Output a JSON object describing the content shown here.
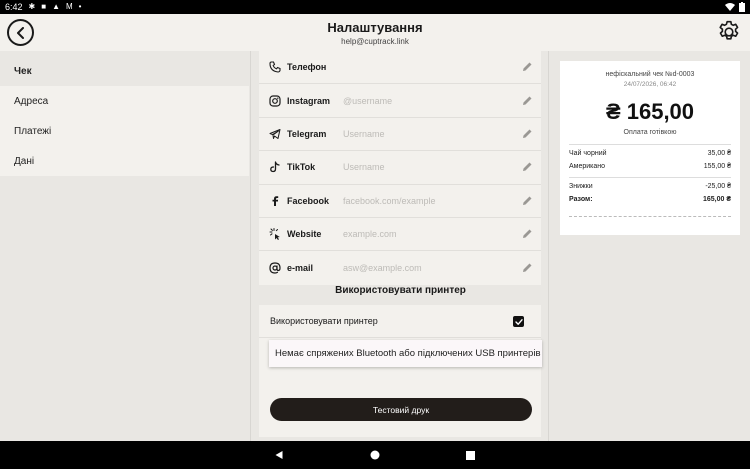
{
  "statusbar": {
    "time": "6:42"
  },
  "header": {
    "title": "Налаштування",
    "subtitle": "help@cuptrack.link"
  },
  "sidebar": {
    "items": [
      {
        "label": "Чек"
      },
      {
        "label": "Адреса"
      },
      {
        "label": "Платежі"
      },
      {
        "label": "Дані"
      }
    ]
  },
  "contacts": {
    "rows": [
      {
        "label": "Телефон",
        "placeholder": "",
        "icon": "phone-icon"
      },
      {
        "label": "Instagram",
        "placeholder": "@username",
        "icon": "instagram-icon"
      },
      {
        "label": "Telegram",
        "placeholder": "Username",
        "icon": "telegram-icon"
      },
      {
        "label": "TikTok",
        "placeholder": "Username",
        "icon": "tiktok-icon"
      },
      {
        "label": "Facebook",
        "placeholder": "facebook.com/example",
        "icon": "facebook-icon"
      },
      {
        "label": "Website",
        "placeholder": "example.com",
        "icon": "website-icon"
      },
      {
        "label": "e-mail",
        "placeholder": "asw@example.com",
        "icon": "email-icon"
      }
    ]
  },
  "printer": {
    "section_title": "Використовувати принтер",
    "toggle_label": "Використовувати принтер",
    "checked": true,
    "test_button": "Тестовий друк",
    "toast": "Немає спряжених Bluetooth або підключених USB принтерів"
  },
  "receipt": {
    "header": "нефіскальний чек №d-0003",
    "date": "24/07/2026, 06:42",
    "total": "₴ 165,00",
    "payment": "Оплата готівкою",
    "items": [
      {
        "name": "Чай чорний",
        "price": "35,00 ₴"
      },
      {
        "name": "Американо",
        "price": "155,00 ₴"
      }
    ],
    "discount": {
      "name": "Знижки",
      "value": "-25,00 ₴"
    },
    "sum": {
      "name": "Разом:",
      "value": "165,00 ₴"
    }
  },
  "colors": {
    "accent": "#221d1a",
    "background": "#e9e7e3",
    "card": "#f3f1ed"
  }
}
